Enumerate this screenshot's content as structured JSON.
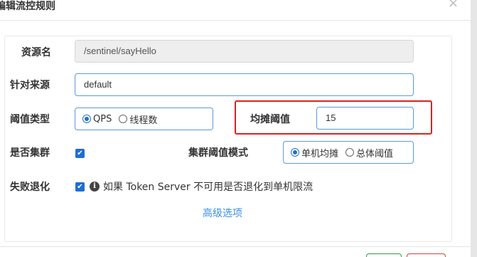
{
  "dialog": {
    "title": "编辑流控规则",
    "close_glyph": "×"
  },
  "form": {
    "resource_label": "资源名",
    "resource_value": "/sentinel/sayHello",
    "origin_label": "针对来源",
    "origin_value": "default",
    "threshold_type_label": "阈值类型",
    "threshold_type_options": [
      "QPS",
      "线程数"
    ],
    "threshold_type_selected": "QPS",
    "threshold_label": "均摊阈值",
    "threshold_value": "15",
    "cluster_label": "是否集群",
    "cluster_checked": true,
    "cluster_mode_label": "集群阈值模式",
    "cluster_mode_options": [
      "单机均摊",
      "总体阈值"
    ],
    "cluster_mode_selected": "单机均摊",
    "fallback_label": "失败退化",
    "fallback_checked": true,
    "fallback_text": "如果 Token Server 不可用是否退化到单机限流",
    "advanced_link": "高级选项"
  },
  "icons": {
    "check": "✔",
    "info": "i"
  },
  "colors": {
    "accent": "#1e6fd0",
    "input_border": "#5b9bd5",
    "highlight": "#e02020",
    "link": "#3a8ee6"
  }
}
